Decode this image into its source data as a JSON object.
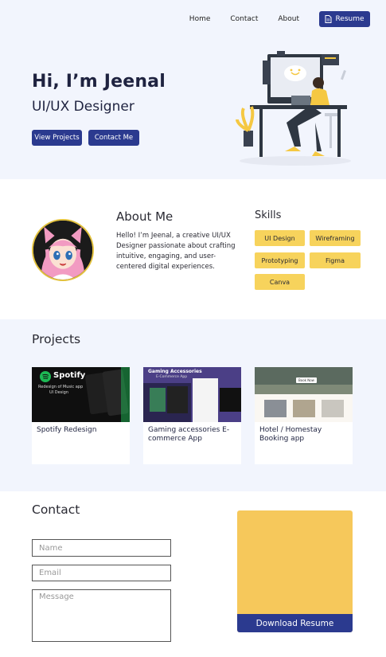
{
  "nav": {
    "links": [
      "Home",
      "Contact",
      "About"
    ],
    "resume_label": "Resume"
  },
  "hero": {
    "title": "Hi, I’m Jeenal",
    "subtitle": "UI/UX Designer",
    "buttons": {
      "projects": "View Projects",
      "contact": "Contact Me"
    },
    "illustration_icon": "designer-at-desk-illustration"
  },
  "about": {
    "title": "About Me",
    "text": "Hello! I’m Jeenal, a creative UI/UX Designer passionate about crafting intuitive, engaging, and user-centered digital experiences.",
    "avatar_icon": "anime-avatar"
  },
  "skills": {
    "title": "Skills",
    "items": [
      "UI Design",
      "Wireframing",
      "Prototyping",
      "Figma",
      "Canva"
    ]
  },
  "projects": {
    "title": "Projects",
    "cards": [
      {
        "label": "Spotify Redesign",
        "thumb_title": "Spotify",
        "thumb_sub1": "Redesign of Music app",
        "thumb_sub2": "UI Design"
      },
      {
        "label": "Gaming accessories E-commerce App",
        "thumb_title": "Gaming Accessories",
        "thumb_sub1": "E-Commerce App"
      },
      {
        "label": "Hotel / Homestay Booking app",
        "thumb_btn": "Book Now"
      }
    ]
  },
  "contact": {
    "title": "Contact",
    "name_placeholder": "Name",
    "email_placeholder": "Email",
    "message_placeholder": "Message",
    "download_label": "Download Resume"
  },
  "colors": {
    "primary": "#2b3a8f",
    "accent_yellow": "#f7d35c",
    "section_bg": "#f2f5fd"
  }
}
